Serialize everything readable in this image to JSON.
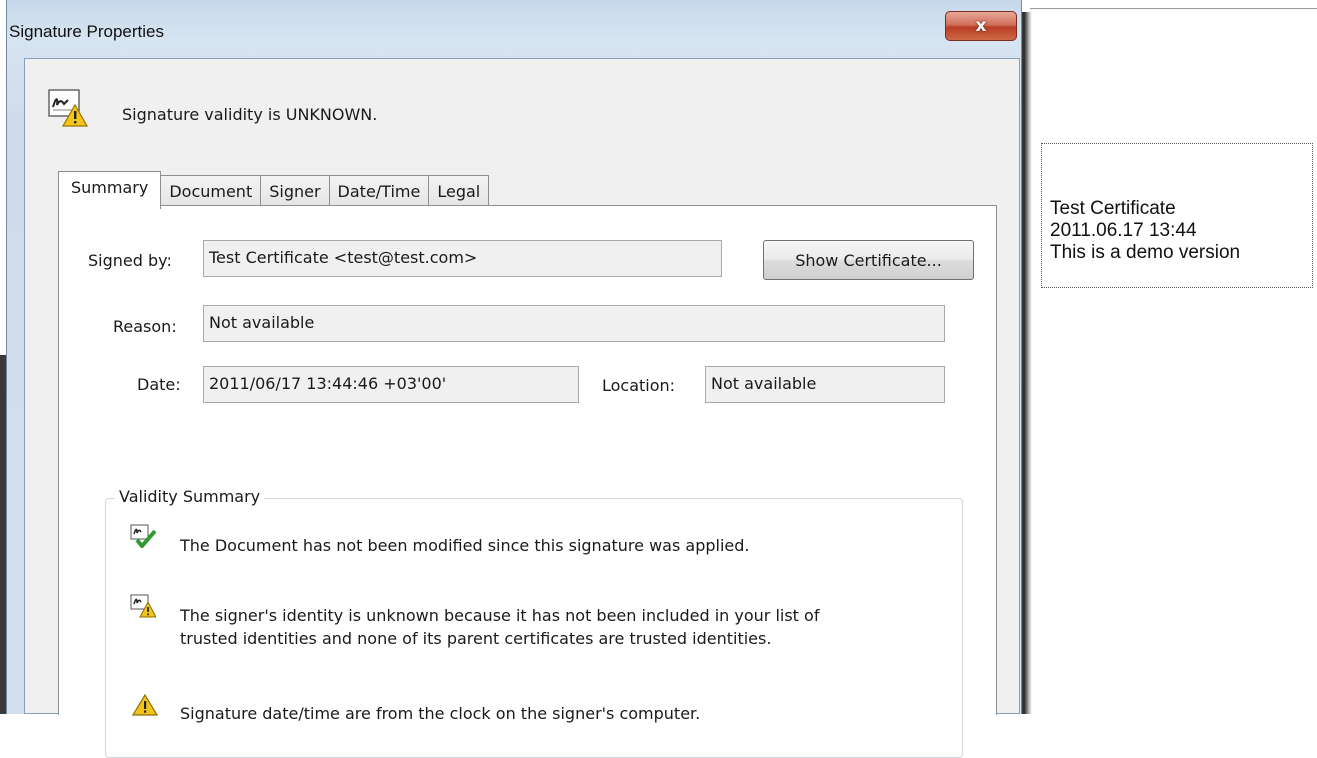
{
  "window": {
    "title": "Signature Properties",
    "close_label": "x"
  },
  "header": {
    "status": "Signature validity is UNKNOWN."
  },
  "tabs": [
    {
      "label": "Summary",
      "active": true
    },
    {
      "label": "Document"
    },
    {
      "label": "Signer"
    },
    {
      "label": "Date/Time"
    },
    {
      "label": "Legal"
    }
  ],
  "summary": {
    "signed_by_label": "Signed by:",
    "signed_by_value": "Test Certificate <test@test.com>",
    "show_certificate_label": "Show Certificate...",
    "reason_label": "Reason:",
    "reason_value": "Not available",
    "date_label": "Date:",
    "date_value": "2011/06/17 13:44:46 +03'00'",
    "location_label": "Location:",
    "location_value": "Not available"
  },
  "validity": {
    "title": "Validity Summary",
    "items": [
      {
        "icon": "doc-unmodified-check-icon",
        "lines": [
          "The Document has not been modified since this signature was applied."
        ]
      },
      {
        "icon": "signer-unknown-warning-icon",
        "lines": [
          "The signer's identity is unknown because it has not been included in your list of",
          "trusted identities and none of its parent certificates are trusted identities."
        ]
      },
      {
        "icon": "warning-icon",
        "lines": [
          "Signature date/time are from the clock on the signer's computer."
        ]
      }
    ]
  },
  "signature_field": {
    "lines": [
      "Test Certificate",
      "2011.06.17 13:44",
      "This is a demo version"
    ]
  },
  "colors": {
    "close_button": "#c4452a",
    "warning": "#f2c318",
    "check": "#3aa33a"
  }
}
